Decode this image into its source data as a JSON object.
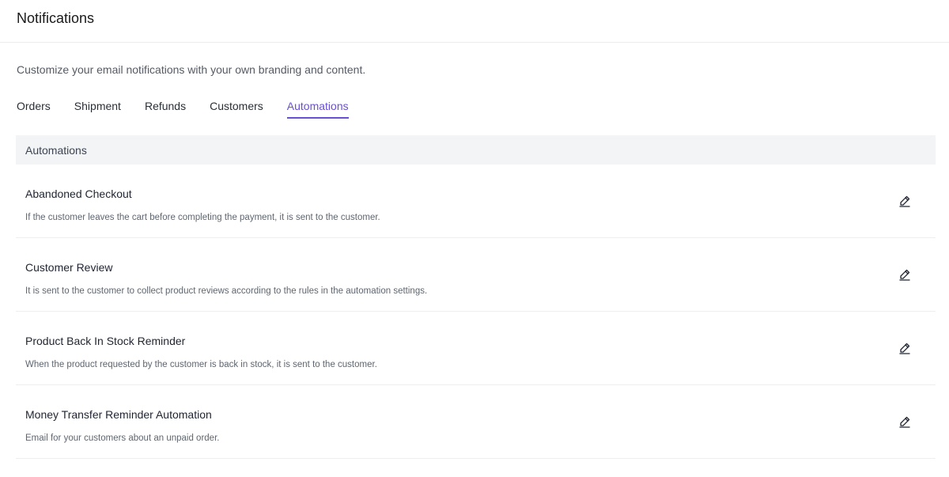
{
  "header": {
    "title": "Notifications"
  },
  "main": {
    "subtitle": "Customize your email notifications with your own branding and content.",
    "tabs": [
      {
        "label": "Orders",
        "active": false
      },
      {
        "label": "Shipment",
        "active": false
      },
      {
        "label": "Refunds",
        "active": false
      },
      {
        "label": "Customers",
        "active": false
      },
      {
        "label": "Automations",
        "active": true
      }
    ],
    "section": {
      "title": "Automations",
      "items": [
        {
          "title": "Abandoned Checkout",
          "description": "If the customer leaves the cart before completing the payment, it is sent to the customer.",
          "action_icon": "edit-pencil-icon"
        },
        {
          "title": "Customer Review",
          "description": "It is sent to the customer to collect product reviews according to the rules in the automation settings.",
          "action_icon": "edit-pencil-icon"
        },
        {
          "title": "Product Back In Stock Reminder",
          "description": "When the product requested by the customer is back in stock, it is sent to the customer.",
          "action_icon": "edit-pencil-icon"
        },
        {
          "title": "Money Transfer Reminder Automation",
          "description": "Email for your customers about an unpaid order.",
          "action_icon": "edit-pencil-icon"
        }
      ]
    }
  },
  "colors": {
    "accent": "#6a4fd6",
    "section_header_bg": "#f2f4f6",
    "divider": "#eceef0"
  }
}
